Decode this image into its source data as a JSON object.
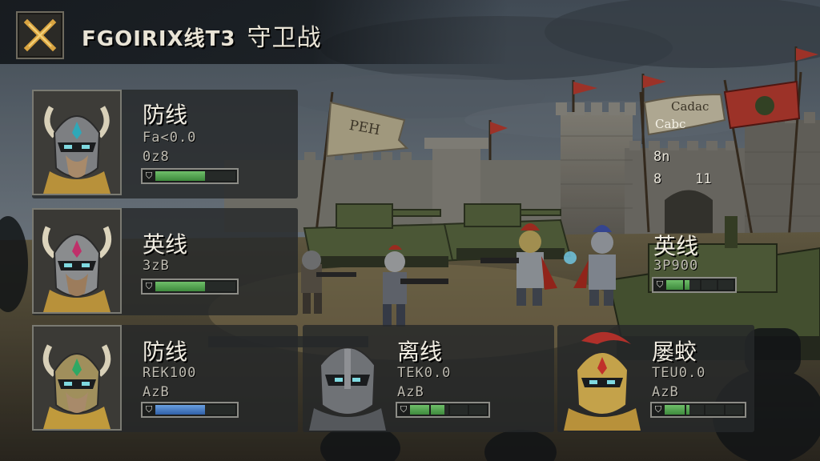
{
  "header": {
    "title_latin": "FGOIRIX线T3",
    "title_cjk": "守卫战"
  },
  "scene": {
    "flag_left_text": "PEH",
    "flag_right_text_line1": "Cadac",
    "flag_right_text_line2": "Cabc",
    "tower_readout_left": "8n",
    "tower_readout_row2_a": "8",
    "tower_readout_row2_b": "11"
  },
  "units": [
    {
      "name": "防线",
      "stat1": "Fa<0.0",
      "stat2": "0z8",
      "hp": 0.62,
      "hp_color": "green"
    },
    {
      "name": "英线",
      "stat1": "3zB",
      "stat2": "",
      "hp": 0.62,
      "hp_color": "green"
    },
    {
      "name": "防线",
      "stat1": "REK100",
      "stat2": "AzB",
      "hp": 0.62,
      "hp_color": "blue"
    },
    {
      "name": "离线",
      "stat1": "TEK0.0",
      "stat2": "AzB",
      "hp": 0.45,
      "hp_color": "green"
    },
    {
      "name": "屡蛟",
      "stat1": "TEU0.0",
      "stat2": "AzB",
      "hp": 0.32,
      "hp_color": "green"
    },
    {
      "name": "英线",
      "stat1": "3P900",
      "stat2": "",
      "hp": 0.35,
      "hp_color": "green"
    }
  ]
}
